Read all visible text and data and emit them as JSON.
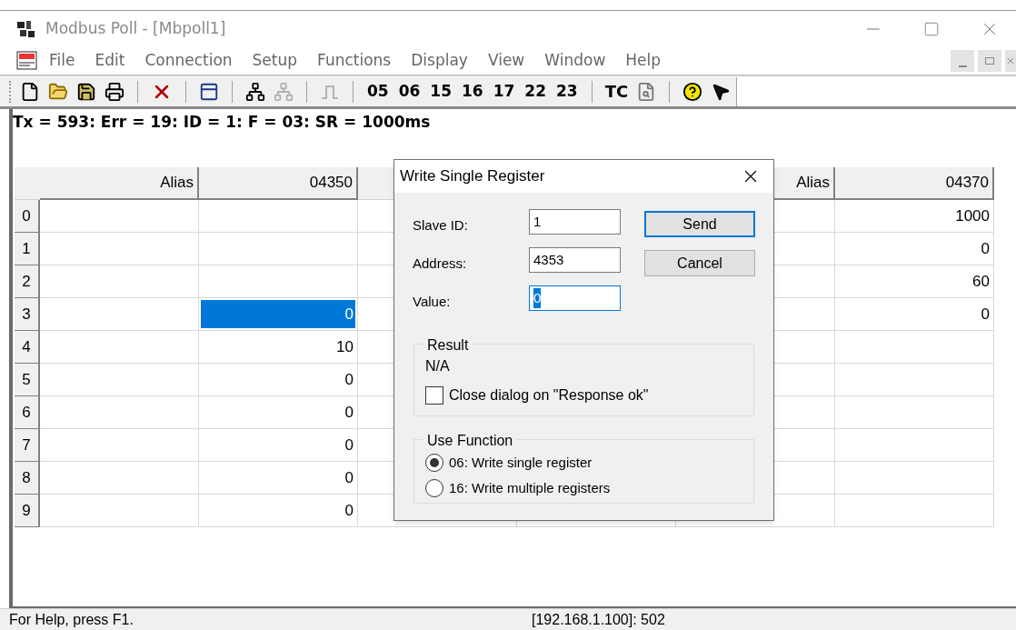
{
  "window": {
    "title": "Modbus Poll - [Mbpoll1]"
  },
  "menu": [
    "File",
    "Edit",
    "Connection",
    "Setup",
    "Functions",
    "Display",
    "View",
    "Window",
    "Help"
  ],
  "toolbar": {
    "function_codes": [
      "05",
      "06",
      "15",
      "16",
      "17",
      "22",
      "23"
    ],
    "tc": "TC"
  },
  "status_line": "Tx = 593: Err = 19: ID = 1: F = 03: SR = 1000ms",
  "grid": {
    "row_labels": [
      "0",
      "1",
      "2",
      "3",
      "4",
      "5",
      "6",
      "7",
      "8",
      "9"
    ],
    "columns": [
      {
        "kind": "alias",
        "header": "Alias"
      },
      {
        "kind": "values",
        "header": "04350",
        "cells": [
          null,
          null,
          null,
          {
            "text": "0",
            "selected": true
          },
          {
            "text": "10",
            "selected": false
          },
          {
            "text": "0",
            "selected": false
          },
          {
            "text": "0",
            "selected": false
          },
          {
            "text": "0",
            "selected": false
          },
          {
            "text": "0",
            "selected": false
          },
          {
            "text": "0",
            "selected": false
          }
        ]
      },
      {
        "kind": "hidden"
      },
      {
        "kind": "hidden"
      },
      {
        "kind": "alias",
        "header": "Alias"
      },
      {
        "kind": "values",
        "header": "04370",
        "cells": [
          {
            "text": "1000",
            "selected": false
          },
          {
            "text": "0",
            "selected": false
          },
          {
            "text": "60",
            "selected": false
          },
          {
            "text": "0",
            "selected": false
          },
          null,
          null,
          null,
          null,
          null,
          null
        ]
      }
    ]
  },
  "dialog": {
    "title": "Write Single Register",
    "fields": [
      {
        "label": "Slave ID:",
        "value": "1",
        "focused": false
      },
      {
        "label": "Address:",
        "value": "4353",
        "focused": false
      },
      {
        "label": "Value:",
        "value": "0",
        "focused": true
      }
    ],
    "buttons": [
      {
        "label": "Send",
        "default": true
      },
      {
        "label": "Cancel",
        "default": false
      }
    ],
    "result": {
      "title": "Result",
      "text": "N/A",
      "checkbox": {
        "label": "Close dialog on \"Response ok\"",
        "checked": false
      }
    },
    "use_function": {
      "title": "Use Function",
      "options": [
        {
          "label": "06: Write single register",
          "selected": true
        },
        {
          "label": "16: Write multiple registers",
          "selected": false
        }
      ]
    }
  },
  "status_bar": [
    "For Help, press F1.",
    "[192.168.1.100]: 502"
  ]
}
